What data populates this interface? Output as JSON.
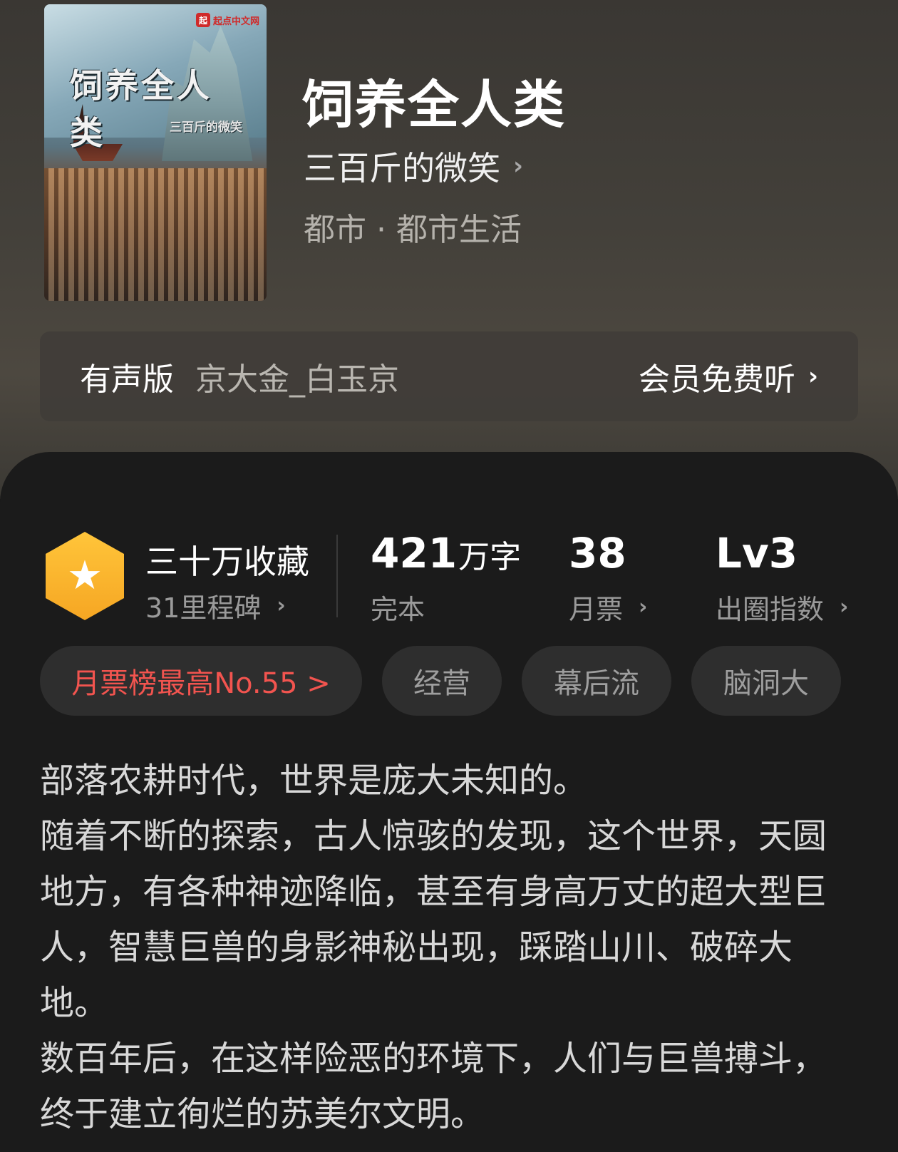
{
  "book": {
    "title": "饲养全人类",
    "author": "三百斤的微笑",
    "genre": "都市 · 都市生活",
    "cover": {
      "title_art": "饲养全人类",
      "subtitle_art": "三百斤的微笑",
      "publisher": "起点中文网",
      "publisher_mark": "起"
    }
  },
  "audio": {
    "label": "有声版",
    "narrator": "京大金_白玉京",
    "cta": "会员免费听"
  },
  "stats": {
    "collection": "三十万收藏",
    "milestone": "31里程碑",
    "word_number": "421",
    "word_unit": "万字",
    "status": "完本",
    "monthly_votes": "38",
    "monthly_votes_label": "月票",
    "level": "Lv3",
    "level_label": "出圈指数"
  },
  "tags": [
    {
      "label": "月票榜最高No.55 >"
    },
    {
      "label": "经营"
    },
    {
      "label": "幕后流"
    },
    {
      "label": "脑洞大"
    }
  ],
  "description": [
    "部落农耕时代，世界是庞大未知的。",
    "随着不断的探索，古人惊骇的发现，这个世界，天圆地方，有各种神迹降临，甚至有身高万丈的超大型巨人，智慧巨兽的身影神秘出现，踩踏山川、破碎大地。",
    "数百年后，在这样险恶的环境下，人们与巨兽搏斗，终于建立徇烂的苏美尔文明。"
  ],
  "colors": {
    "accent_red": "#f2544f",
    "badge_gold": "#f6a623",
    "panel_bg": "#1b1b1b"
  },
  "icons": {
    "chevron": "›",
    "star": "★"
  }
}
